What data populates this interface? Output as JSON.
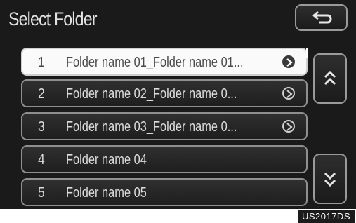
{
  "header": {
    "title": "Select Folder"
  },
  "back_button": {
    "icon": "return-arrow-icon"
  },
  "folders": [
    {
      "number": "1",
      "name": "Folder name 01_Folder name 01...",
      "has_arrow": true,
      "selected": true
    },
    {
      "number": "2",
      "name": "Folder name 02_Folder name 0...",
      "has_arrow": true,
      "selected": false
    },
    {
      "number": "3",
      "name": "Folder name 03_Folder name 0...",
      "has_arrow": true,
      "selected": false
    },
    {
      "number": "4",
      "name": "Folder name 04",
      "has_arrow": false,
      "selected": false
    },
    {
      "number": "5",
      "name": "Folder name 05",
      "has_arrow": false,
      "selected": false
    }
  ],
  "scroll": {
    "up_icon": "double-chevron-up-icon",
    "down_icon": "double-chevron-down-icon"
  },
  "footer": {
    "code": "US2017DS"
  },
  "colors": {
    "screen_bg": "#1a1a1a",
    "selected_row_bg": "#fafafa",
    "border": "#8f8f8f"
  }
}
